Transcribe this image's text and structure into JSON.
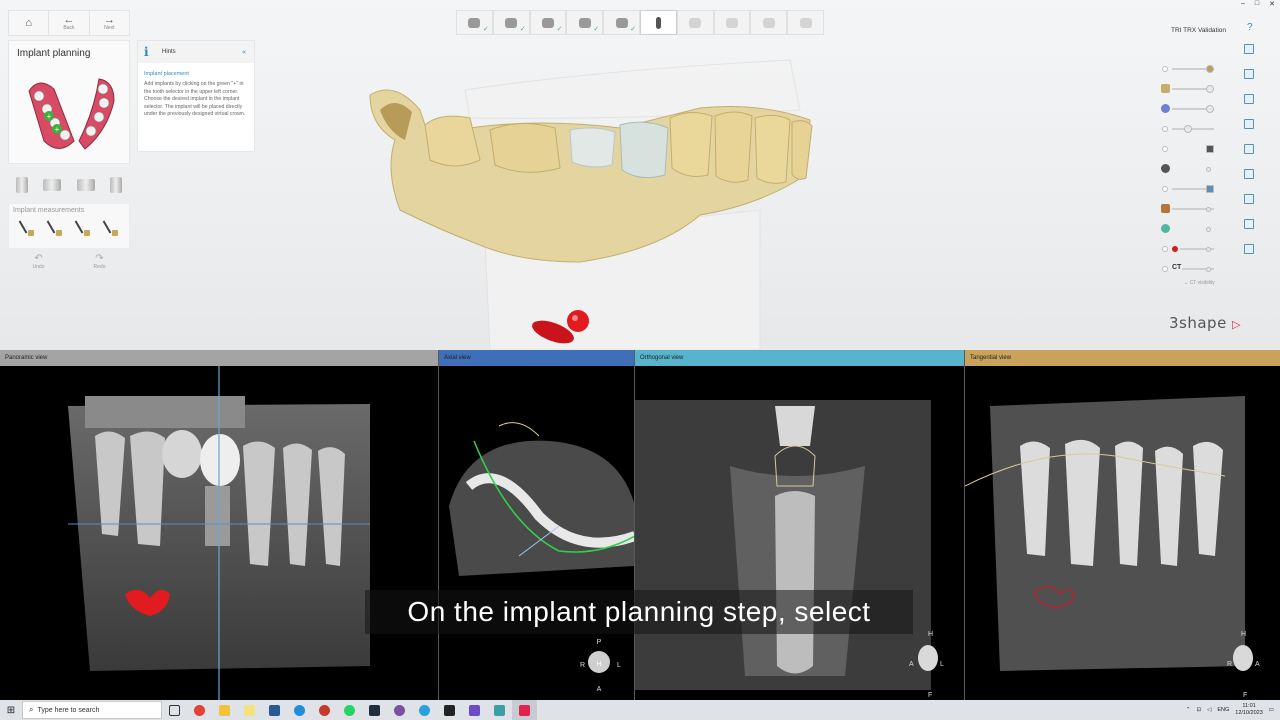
{
  "nav": {
    "back_label": "Back",
    "next_label": "Next"
  },
  "step_panel": {
    "title": "Implant planning"
  },
  "hints": {
    "title": "Hints",
    "subtitle": "Implant placement",
    "body": "Add implants by clicking on the green \"+\" in the tooth selector in the upper left corner. Choose the desired implant in the implant selector. The implant will be placed directly under the previously designed virtual crown."
  },
  "measurements": {
    "title": "Implant measurements"
  },
  "edit": {
    "undo_label": "Undo",
    "redo_label": "Redo"
  },
  "right_panel": {
    "title": "TRI TRX Validation",
    "ct_label": "CT",
    "ct_visibility": "CT visibility"
  },
  "logo": {
    "text": "3shape"
  },
  "views": {
    "panoramic": {
      "label": "Panoramic view",
      "color": "#9a9a9a"
    },
    "axial": {
      "label": "Axial view",
      "color": "#3f6fb8"
    },
    "orthogonal": {
      "label": "Orthogonal view",
      "color": "#58b3cc"
    },
    "tangential": {
      "label": "Tangential view",
      "color": "#c9a35c"
    }
  },
  "orientation": {
    "axial": {
      "top": "P",
      "left": "R",
      "center": "H",
      "right": "L",
      "bottom": "A"
    },
    "orthogonal": {
      "top": "H",
      "left": "A",
      "right": "L",
      "bottom": "F"
    },
    "tangential": {
      "top": "H",
      "left": "R",
      "right": "A",
      "bottom": "F"
    }
  },
  "caption": "On the implant planning step, select",
  "taskbar": {
    "search_placeholder": "Type here to search",
    "lang": "ENG",
    "time": "11:01",
    "date": "12/10/2023"
  },
  "colors": {
    "accent": "#2a8dbf",
    "brand": "#e0224d",
    "implant_marker": "#d8191d",
    "nerve_curve": "#2fd14a"
  }
}
